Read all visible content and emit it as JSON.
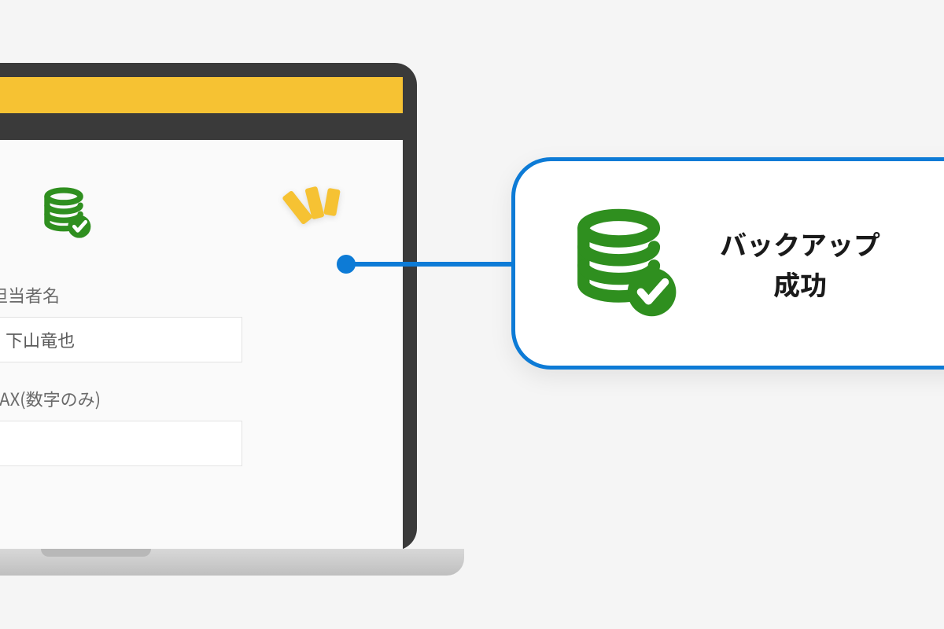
{
  "colors": {
    "accent_yellow": "#f6c233",
    "accent_blue": "#3b9ae1",
    "callout_blue": "#0d7bd6",
    "success_green": "#2f8f1f"
  },
  "toolbar": {
    "dropdown_icon": "chevron-down",
    "filter_icon": "funnel",
    "chart_icon": "bar-chart",
    "backup_icon": "database-check"
  },
  "form": {
    "contact_label": "担当者名",
    "contact_value": "下山竜也",
    "fax_label": "FAX(数字のみ)",
    "fax_value": ""
  },
  "callout": {
    "line1": "バックアップ",
    "line2": "成功"
  }
}
